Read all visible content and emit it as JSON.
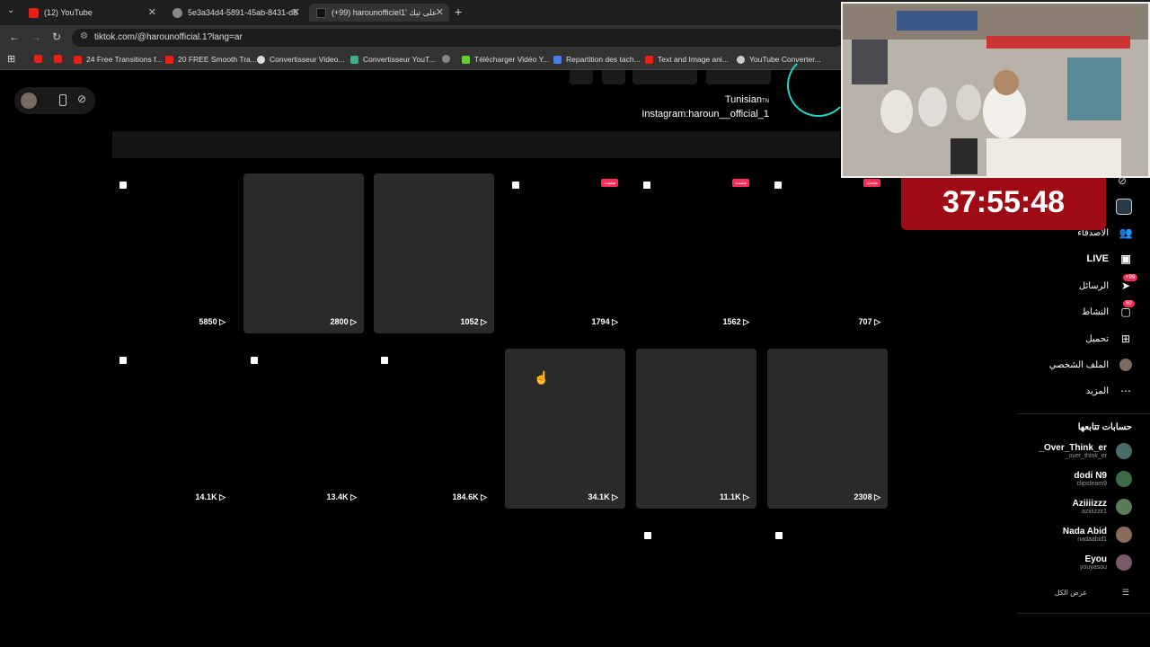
{
  "tabs": [
    {
      "title": "(12) YouTube",
      "active": false
    },
    {
      "title": "5e3a34d4-5891-45ab-8431-d5",
      "active": false
    },
    {
      "title": "(+99) harounofficiel1' على تيك",
      "active": true
    }
  ],
  "url": "tiktok.com/@harounofficial.1?lang=ar",
  "bookmarks": [
    "24 Free Transitions f...",
    "20 FREE Smooth Tra...",
    "Convertisseur Video...",
    "Convertisseur YouT...",
    "Télécharger Vidéo Y...",
    "Repartition des tach...",
    "Text and Image ani...",
    "YouTube Converter..."
  ],
  "bio": {
    "line1": "Tunisian",
    "flag": "TN",
    "line2": "Instagram:haroun__official_1"
  },
  "videos": [
    {
      "views": "5850",
      "filled": false,
      "multi": true,
      "pinned": false
    },
    {
      "views": "2800",
      "filled": true,
      "multi": false,
      "pinned": false
    },
    {
      "views": "1052",
      "filled": true,
      "multi": false,
      "pinned": false
    },
    {
      "views": "1794",
      "filled": false,
      "multi": true,
      "pinned": true
    },
    {
      "views": "1562",
      "filled": false,
      "multi": true,
      "pinned": true
    },
    {
      "views": "707",
      "filled": false,
      "multi": true,
      "pinned": true
    },
    {
      "views": "14.1K",
      "filled": false,
      "multi": true,
      "pinned": false
    },
    {
      "views": "13.4K",
      "filled": false,
      "multi": true,
      "pinned": false
    },
    {
      "views": "184.6K",
      "filled": false,
      "multi": true,
      "pinned": false
    },
    {
      "views": "34.1K",
      "filled": true,
      "multi": false,
      "pinned": false
    },
    {
      "views": "11.1K",
      "filled": true,
      "multi": false,
      "pinned": false
    },
    {
      "views": "2308",
      "filled": true,
      "multi": false,
      "pinned": false
    }
  ],
  "pinned_label": "مثبت",
  "sidebar": {
    "friends": "الأصدقاء",
    "live": "LIVE",
    "messages": "الرسائل",
    "messages_badge": "+99",
    "activity": "النشاط",
    "activity_badge": "60",
    "upload": "تحميل",
    "profile": "الملف الشخصي",
    "more": "المزيد",
    "following_header": "حسابات تتابعها",
    "see_all": "عرض الكل"
  },
  "following": [
    {
      "name": "_Over_Think_er",
      "handle": "_over_think_er",
      "color": "#4a6b6a"
    },
    {
      "name": "dodi N9",
      "handle": "clipsteam9",
      "color": "#3d6b4a"
    },
    {
      "name": "Aziiiizzz",
      "handle": "aziiiizzz1",
      "color": "#5a7a5a"
    },
    {
      "name": "Nada Abid",
      "handle": "nadaabid1",
      "color": "#8a6a5a"
    },
    {
      "name": "Eyou",
      "handle": "youyasou",
      "color": "#7a5a6a"
    }
  ],
  "timer": "37:55:48",
  "colors": {
    "accent": "#fe2c55",
    "timer_bg": "#9e0b14"
  }
}
